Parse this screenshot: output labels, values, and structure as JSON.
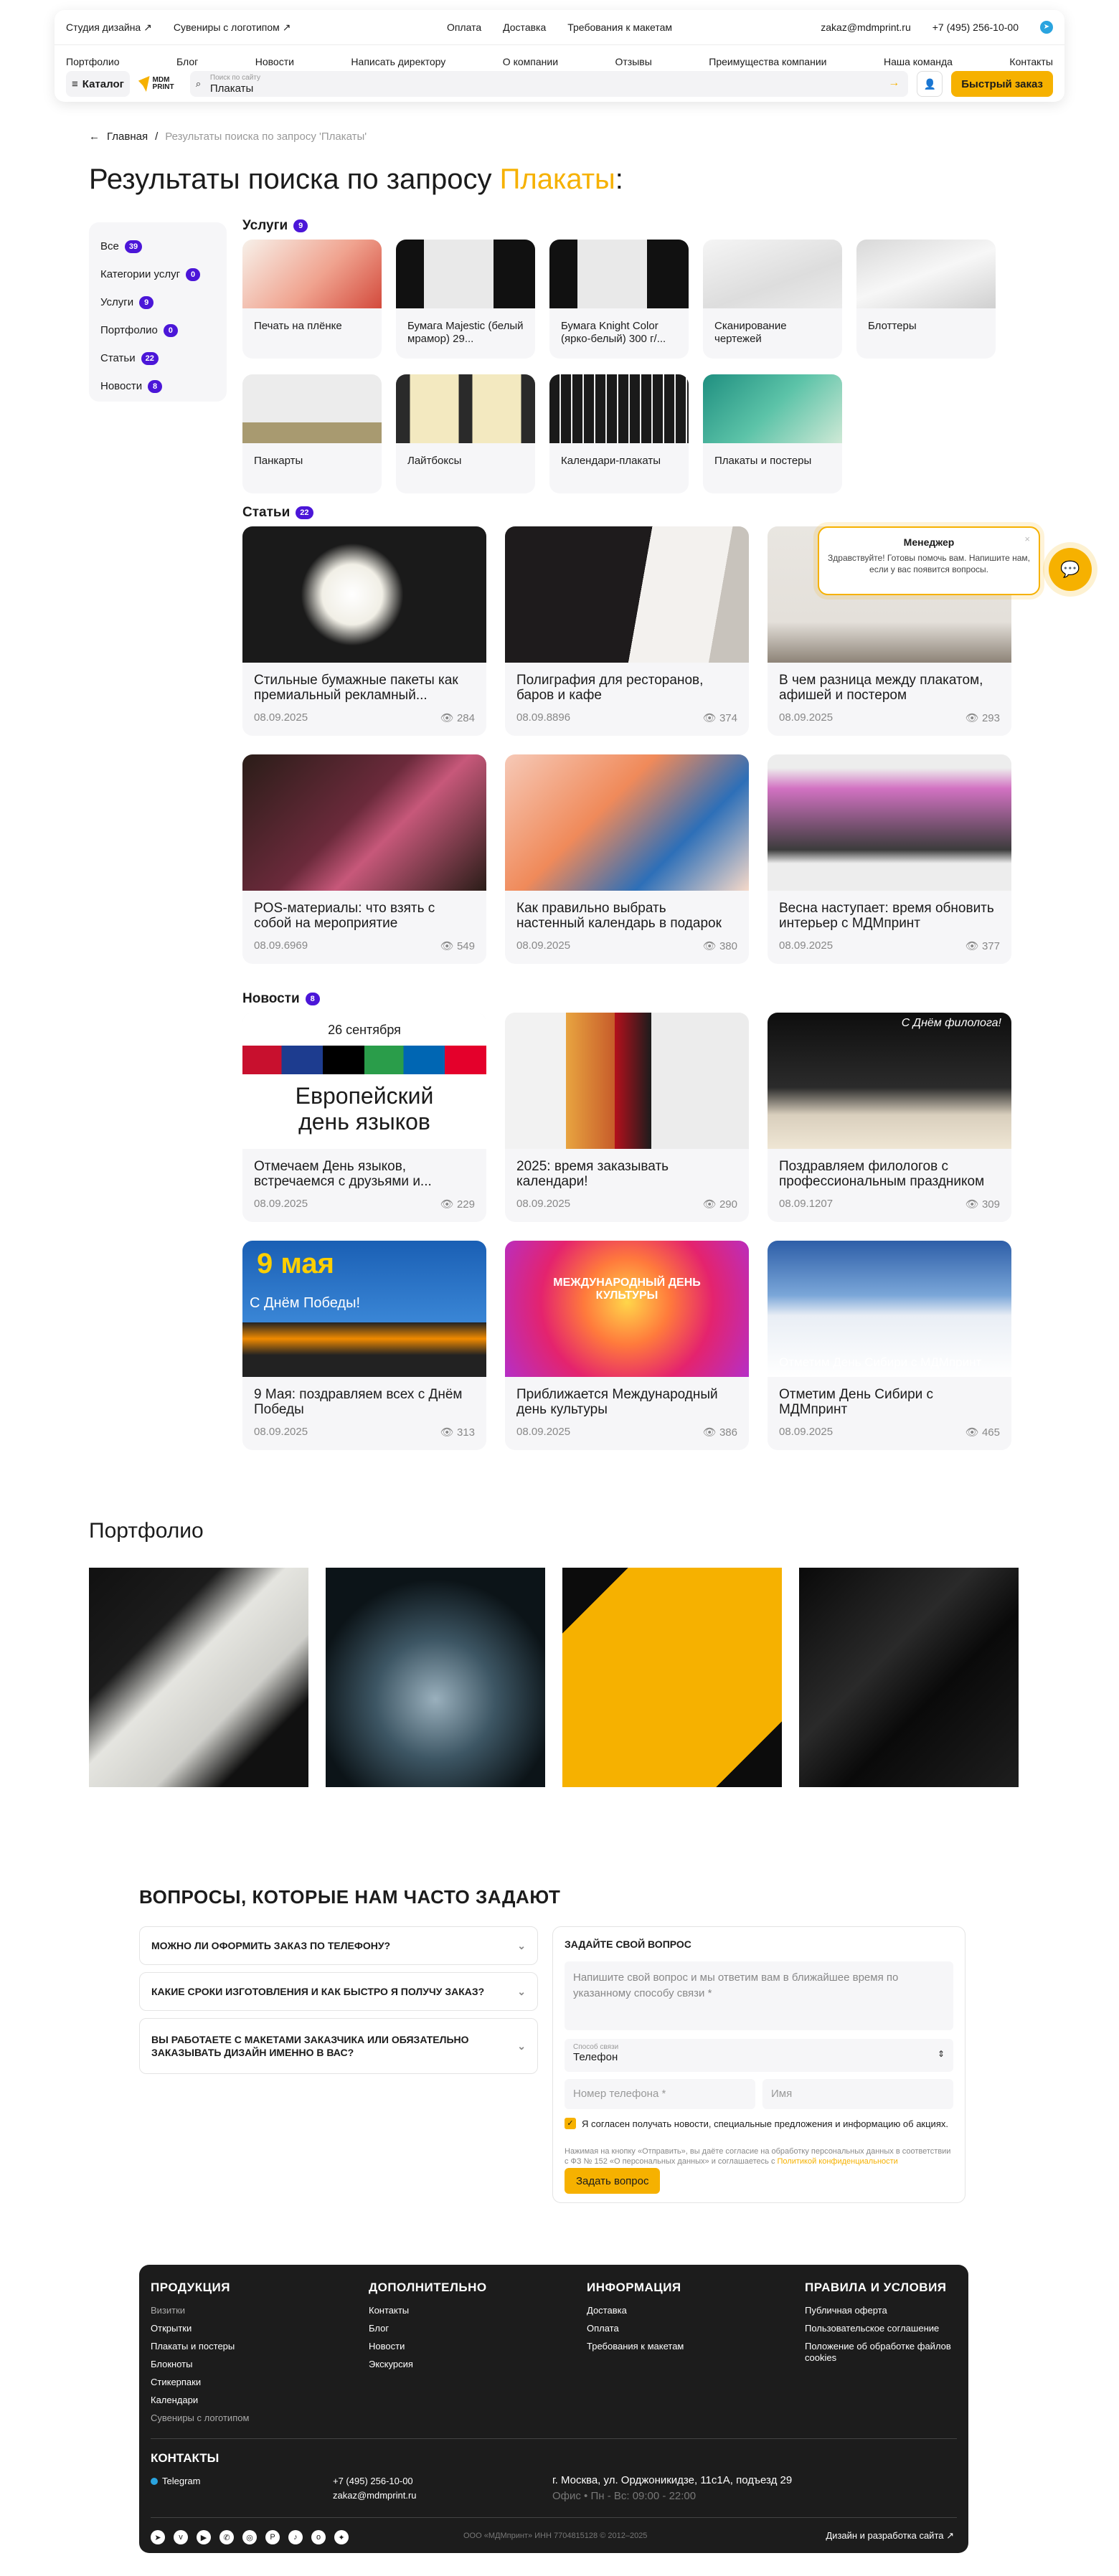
{
  "header": {
    "top_left": [
      "Студия дизайна ↗",
      "Сувениры с логотипом ↗"
    ],
    "top_center": [
      "Оплата",
      "Доставка",
      "Требования к макетам"
    ],
    "email": "zakaz@mdmprint.ru",
    "phone": "+7 (495) 256-10-00",
    "nav": [
      "Портфолио",
      "Блог",
      "Новости",
      "Написать директору",
      "О компании",
      "Отзывы",
      "Преимущества компании",
      "Наша команда",
      "Контакты"
    ],
    "catalog": "Каталог",
    "logo_text": "MDM PRINT",
    "search_label": "Поиск по сайту",
    "search_value": "Плакаты",
    "quick_order": "Быстрый заказ"
  },
  "breadcrumb": {
    "home": "Главная",
    "sep": "/",
    "current": "Результаты поиска по запросу 'Плакаты'"
  },
  "title": {
    "prefix": "Результаты поиска по запросу ",
    "query": "Плакаты",
    "suffix": ":"
  },
  "sidebar": [
    {
      "label": "Все",
      "count": "39"
    },
    {
      "label": "Категории услуг",
      "count": "0"
    },
    {
      "label": "Услуги",
      "count": "9"
    },
    {
      "label": "Портфолио",
      "count": "0"
    },
    {
      "label": "Статьи",
      "count": "22"
    },
    {
      "label": "Новости",
      "count": "8"
    }
  ],
  "services": {
    "title": "Услуги",
    "count": "9",
    "items": [
      "Печать на плёнке",
      "Бумага Majestic (белый мрамор) 29...",
      "Бумага Knight Color (ярко-белый) 300 г/...",
      "Сканирование чертежей",
      "Блоттеры",
      "Панкарты",
      "Лайтбоксы",
      "Календари-плакаты",
      "Плакаты и постеры"
    ]
  },
  "articles": {
    "title": "Статьи",
    "count": "22",
    "items": [
      {
        "title": "Стильные бумажные пакеты как премиальный рекламный...",
        "date": "08.09.2025",
        "views": "284"
      },
      {
        "title": "Полиграфия для ресторанов, баров и кафе",
        "date": "08.09.8896",
        "views": "374"
      },
      {
        "title": "В чем разница между плакатом, афишей и постером",
        "date": "08.09.2025",
        "views": "293"
      },
      {
        "title": "POS-материалы: что взять с собой на мероприятие",
        "date": "08.09.6969",
        "views": "549"
      },
      {
        "title": "Как правильно выбрать настенный календарь в подарок",
        "date": "08.09.2025",
        "views": "380"
      },
      {
        "title": "Весна наступает: время обновить интерьер с МДМпринт",
        "date": "08.09.2025",
        "views": "377"
      }
    ]
  },
  "news": {
    "title": "Новости",
    "count": "8",
    "items": [
      {
        "title": "Отмечаем День языков, встречаемся с друзьями и...",
        "date": "08.09.2025",
        "views": "229"
      },
      {
        "title": "2025: время заказывать календари!",
        "date": "08.09.2025",
        "views": "290"
      },
      {
        "title": "Поздравляем филологов с профессиональным праздником",
        "date": "08.09.1207",
        "views": "309"
      },
      {
        "title": "9 Мая: поздравляем всех с Днём Победы",
        "date": "08.09.2025",
        "views": "313"
      },
      {
        "title": "Приближается Международный день культуры",
        "date": "08.09.2025",
        "views": "386"
      },
      {
        "title": "Отметим День Сибири с МДМпринт",
        "date": "08.09.2025",
        "views": "465"
      }
    ]
  },
  "news_img_text": {
    "n1_date": "26 сентября",
    "n1_line1": "Европейский",
    "n1_line2": "день языков",
    "n3": "С Днём филолога!",
    "n4_a": "9 мая",
    "n4_b": "С Днём Победы!",
    "n5": "МЕЖДУНАРОДНЫЙ ДЕНЬ КУЛЬТУРЫ",
    "n6": "Отметим День Сибири с МДМпринт"
  },
  "portfolio": {
    "title": "Портфолио"
  },
  "faq": {
    "title": "ВОПРОСЫ, КОТОРЫЕ НАМ ЧАСТО ЗАДАЮТ",
    "items": [
      "МОЖНО ЛИ ОФОРМИТЬ ЗАКАЗ ПО ТЕЛЕФОНУ?",
      "КАКИЕ СРОКИ ИЗГОТОВЛЕНИЯ И КАК БЫСТРО Я ПОЛУЧУ ЗАКАЗ?",
      "ВЫ РАБОТАЕТЕ С МАКЕТАМИ ЗАКАЗЧИКА ИЛИ ОБЯЗАТЕЛЬНО ЗАКАЗЫВАТЬ ДИЗАЙН ИМЕННО В ВАС?"
    ]
  },
  "form": {
    "title": "ЗАДАЙТЕ СВОЙ ВОПРОС",
    "question_ph": "Напишите свой вопрос и мы ответим вам в ближайшее время по указанному способу связи *",
    "contact_label": "Способ связи",
    "contact_value": "Телефон",
    "phone_ph": "Номер телефона *",
    "name_ph": "Имя",
    "consent": "Я согласен получать новости, специальные предложения и информацию об акциях.",
    "note": "Нажимая на кнопку «Отправить», вы даёте согласие на обработку персональных данных в соответствии с ФЗ № 152 «О персональных данных» и соглашаетесь с ",
    "note_link": "Политикой конфиденциальности",
    "submit": "Задать вопрос"
  },
  "chat": {
    "name": "Менеджер",
    "message": "Здравствуйте! Готовы помочь вам. Напишите нам, если у вас появится вопросы."
  },
  "footer": {
    "col1": {
      "title": "ПРОДУКЦИЯ",
      "items": [
        "Визитки",
        "Открытки",
        "Плакаты и постеры",
        "Блокноты",
        "Стикерпаки",
        "Календари",
        "Сувениры с логотипом"
      ]
    },
    "col2": {
      "title": "ДОПОЛНИТЕЛЬНО",
      "items": [
        "Контакты",
        "Блог",
        "Новости",
        "Экскурсия"
      ]
    },
    "col3": {
      "title": "ИНФОРМАЦИЯ",
      "items": [
        "Доставка",
        "Оплата",
        "Требования к макетам"
      ]
    },
    "col4": {
      "title": "ПРАВИЛА И УСЛОВИЯ",
      "items": [
        "Публичная оферта",
        "Пользовательское соглашение",
        "Положение об обработке файлов cookies"
      ]
    },
    "contacts_title": "КОНТАКТЫ",
    "telegram": "Telegram",
    "phone": "+7 (495) 256-10-00",
    "email": "zakaz@mdmprint.ru",
    "address": "г. Москва, ул. Орджоникидзе, 11с1А, подъезд 29",
    "hours": "Офис • Пн - Вс: 09:00 - 22:00",
    "legal": "ООО «МДМпринт»   ИНН 7704815128   © 2012–2025",
    "dev": "Дизайн и разработка сайта ↗"
  },
  "colors": {
    "accent": "#f6b100",
    "badge": "#4b16d8",
    "footer_bg": "#1c1c1c"
  }
}
